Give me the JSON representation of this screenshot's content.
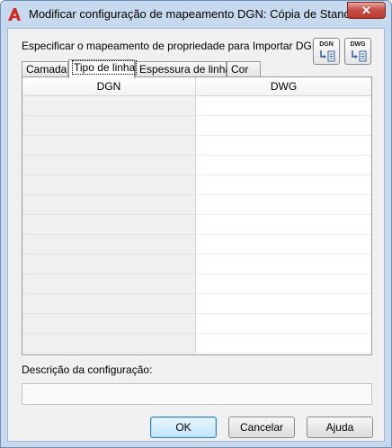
{
  "window": {
    "title": "Modificar configuração de mapeamento DGN: Cópia de Standard",
    "close_symbol": "✕",
    "app_icon": "autocad-a-icon"
  },
  "prompt": "Especificar o mapeamento de propriedade para Importar DGN",
  "tools": [
    {
      "label": "DGN",
      "icon": "import-dgn-icon"
    },
    {
      "label": "DWG",
      "icon": "import-dwg-icon"
    }
  ],
  "tabs": [
    {
      "label": "Camada",
      "active": false
    },
    {
      "label": "Tipo de linha",
      "active": true
    },
    {
      "label": "Espessura de linha",
      "active": false
    },
    {
      "label": "Cor",
      "active": false
    }
  ],
  "grid": {
    "headers": [
      "DGN",
      "DWG"
    ],
    "row_count": 13
  },
  "description": {
    "label": "Descrição da configuração:",
    "value": ""
  },
  "buttons": {
    "ok": "OK",
    "cancel": "Cancelar",
    "help": "Ajuda"
  },
  "colors": {
    "frame": "#c7d9ee",
    "close_button": "#c75050",
    "default_button": "#bee6fd"
  }
}
